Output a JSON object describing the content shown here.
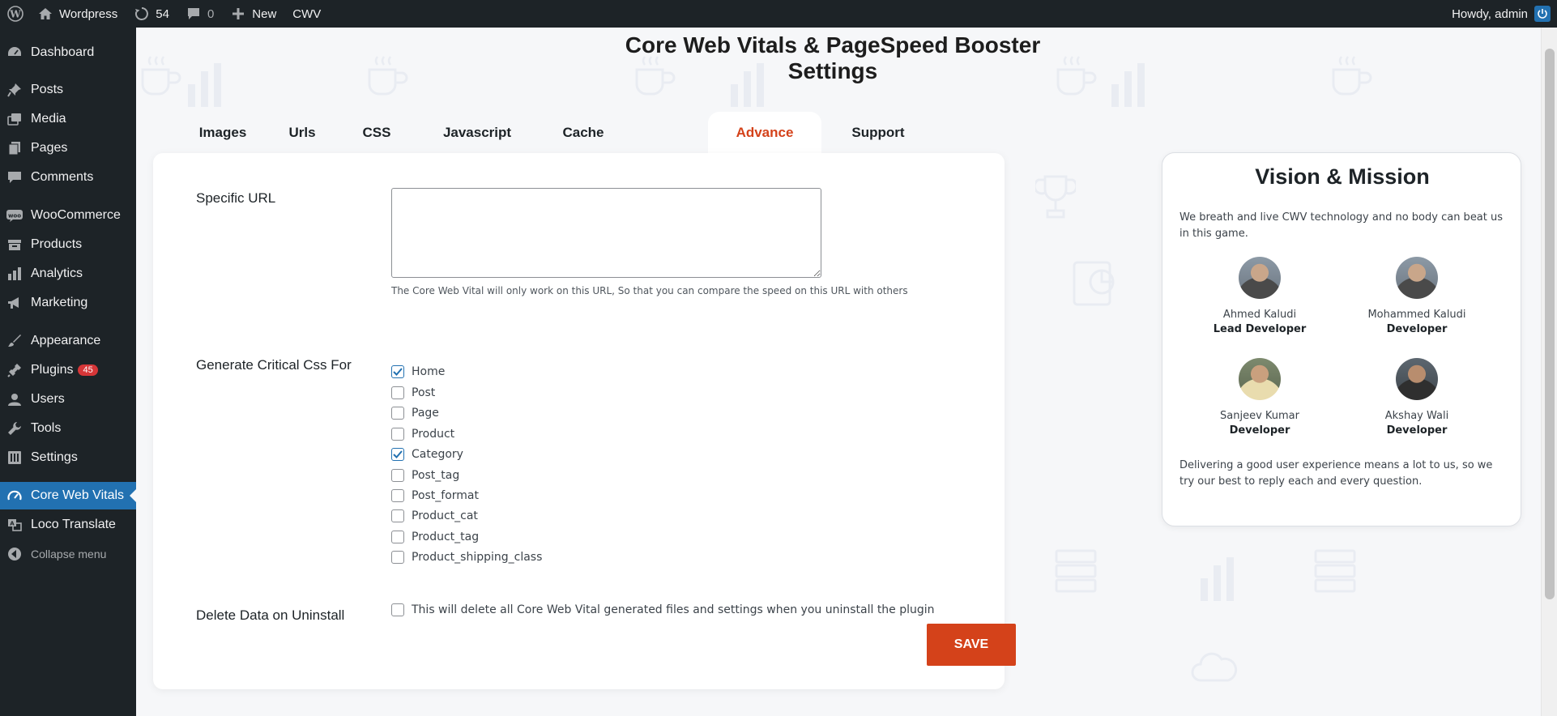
{
  "admin_bar": {
    "site_name": "Wordpress",
    "updates_count": "54",
    "comments_count": "0",
    "new_label": "New",
    "cwv_label": "CWV",
    "greeting": "Howdy, admin"
  },
  "sidebar": {
    "items": [
      {
        "label": "Dashboard",
        "icon": "dashboard-icon"
      },
      {
        "label": "Posts",
        "icon": "pin-icon"
      },
      {
        "label": "Media",
        "icon": "media-icon"
      },
      {
        "label": "Pages",
        "icon": "pages-icon"
      },
      {
        "label": "Comments",
        "icon": "comments-icon"
      },
      {
        "label": "WooCommerce",
        "icon": "woocommerce-icon"
      },
      {
        "label": "Products",
        "icon": "products-icon"
      },
      {
        "label": "Analytics",
        "icon": "analytics-icon"
      },
      {
        "label": "Marketing",
        "icon": "megaphone-icon"
      },
      {
        "label": "Appearance",
        "icon": "brush-icon"
      },
      {
        "label": "Plugins",
        "icon": "plugin-icon",
        "badge": "45"
      },
      {
        "label": "Users",
        "icon": "users-icon"
      },
      {
        "label": "Tools",
        "icon": "wrench-icon"
      },
      {
        "label": "Settings",
        "icon": "settings-icon"
      },
      {
        "label": "Core Web Vitals",
        "icon": "cwv-icon"
      },
      {
        "label": "Loco Translate",
        "icon": "translate-icon"
      },
      {
        "label": "Collapse menu",
        "icon": "collapse-icon"
      }
    ]
  },
  "page": {
    "title": "Core Web Vitals & PageSpeed Booster Settings"
  },
  "tabs": [
    "Images",
    "Urls",
    "CSS",
    "Javascript",
    "Cache",
    "Advance",
    "Support"
  ],
  "active_tab": "Advance",
  "form": {
    "specific_url_label": "Specific URL",
    "specific_url_value": "",
    "specific_url_help": "The Core Web Vital will only work on this URL, So that you can compare the speed on this URL with others",
    "critical_css_label": "Generate Critical Css For",
    "critical_css_options": [
      {
        "label": "Home",
        "checked": true
      },
      {
        "label": "Post",
        "checked": false
      },
      {
        "label": "Page",
        "checked": false
      },
      {
        "label": "Product",
        "checked": false
      },
      {
        "label": "Category",
        "checked": true
      },
      {
        "label": "Post_tag",
        "checked": false
      },
      {
        "label": "Post_format",
        "checked": false
      },
      {
        "label": "Product_cat",
        "checked": false
      },
      {
        "label": "Product_tag",
        "checked": false
      },
      {
        "label": "Product_shipping_class",
        "checked": false
      }
    ],
    "delete_data_label": "Delete Data on Uninstall",
    "delete_data_text": "This will delete all Core Web Vital generated files and settings when you uninstall the plugin",
    "delete_data_checked": false,
    "save_label": "SAVE"
  },
  "vision_card": {
    "title": "Vision & Mission",
    "intro": "We breath and live CWV technology and no body can beat us in this game.",
    "members": [
      {
        "name": "Ahmed Kaludi",
        "role": "Lead Developer"
      },
      {
        "name": "Mohammed Kaludi",
        "role": "Developer"
      },
      {
        "name": "Sanjeev Kumar",
        "role": "Developer"
      },
      {
        "name": "Akshay Wali",
        "role": "Developer"
      }
    ],
    "outro": "Delivering a good user experience means a lot to us, so we try our best to reply each and every question."
  },
  "colors": {
    "accent": "#d4421a",
    "admin_bg": "#1d2327",
    "wp_blue": "#2271b1"
  }
}
